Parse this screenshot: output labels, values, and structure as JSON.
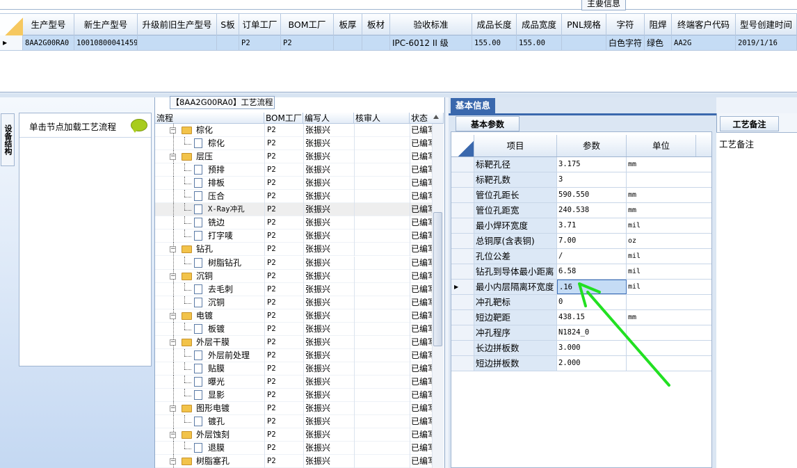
{
  "top_panel": {
    "tab_label": "主要信息",
    "columns": [
      "生产型号",
      "新生产型号",
      "升级前旧生产型号",
      "S板",
      "订单工厂",
      "BOM工厂",
      "板厚",
      "板材",
      "验收标准",
      "成品长度",
      "成品宽度",
      "PNL规格",
      "字符",
      "阻焊",
      "终端客户代码",
      "型号创建时间"
    ],
    "row": [
      "8AA2G00RA0",
      "10010800041459",
      "",
      "",
      "P2",
      "P2",
      "",
      "",
      "IPC-6012 II 级",
      "155.00",
      "155.00",
      "",
      "白色字符",
      "绿色",
      "AA2G",
      "2019/1/16"
    ],
    "row_indicator": "▶"
  },
  "left_panel": {
    "vertical_tab": "设备结构",
    "hint_text": "单击节点加载工艺流程",
    "bubble_icon": "speech-bubble-icon"
  },
  "process_panel": {
    "tab_label": "【8AA2G00RA0】工艺流程",
    "columns": [
      "流程",
      "BOM工厂",
      "编写人",
      "核审人",
      "状态"
    ],
    "rows": [
      {
        "name": "棕化",
        "level": 0,
        "bom": "P2",
        "author": "张振兴",
        "reviewer": "",
        "status": "已编写"
      },
      {
        "name": "棕化",
        "level": 1,
        "bom": "P2",
        "author": "张振兴",
        "reviewer": "",
        "status": "已编写"
      },
      {
        "name": "层压",
        "level": 0,
        "bom": "P2",
        "author": "张振兴",
        "reviewer": "",
        "status": "已编写"
      },
      {
        "name": "预排",
        "level": 1,
        "bom": "P2",
        "author": "张振兴",
        "reviewer": "",
        "status": "已编写"
      },
      {
        "name": "排板",
        "level": 1,
        "bom": "P2",
        "author": "张振兴",
        "reviewer": "",
        "status": "已编写"
      },
      {
        "name": "压合",
        "level": 1,
        "bom": "P2",
        "author": "张振兴",
        "reviewer": "",
        "status": "已编写"
      },
      {
        "name": "X-Ray冲孔",
        "level": 1,
        "bom": "P2",
        "author": "张振兴",
        "reviewer": "",
        "status": "已编写"
      },
      {
        "name": "铣边",
        "level": 1,
        "bom": "P2",
        "author": "张振兴",
        "reviewer": "",
        "status": "已编写"
      },
      {
        "name": "打字唛",
        "level": 1,
        "bom": "P2",
        "author": "张振兴",
        "reviewer": "",
        "status": "已编写"
      },
      {
        "name": "钻孔",
        "level": 0,
        "bom": "P2",
        "author": "张振兴",
        "reviewer": "",
        "status": "已编写"
      },
      {
        "name": "树脂钻孔",
        "level": 1,
        "bom": "P2",
        "author": "张振兴",
        "reviewer": "",
        "status": "已编写"
      },
      {
        "name": "沉铜",
        "level": 0,
        "bom": "P2",
        "author": "张振兴",
        "reviewer": "",
        "status": "已编写"
      },
      {
        "name": "去毛刺",
        "level": 1,
        "bom": "P2",
        "author": "张振兴",
        "reviewer": "",
        "status": "已编写"
      },
      {
        "name": "沉铜",
        "level": 1,
        "bom": "P2",
        "author": "张振兴",
        "reviewer": "",
        "status": "已编写"
      },
      {
        "name": "电镀",
        "level": 0,
        "bom": "P2",
        "author": "张振兴",
        "reviewer": "",
        "status": "已编写"
      },
      {
        "name": "板镀",
        "level": 1,
        "bom": "P2",
        "author": "张振兴",
        "reviewer": "",
        "status": "已编写"
      },
      {
        "name": "外层干膜",
        "level": 0,
        "bom": "P2",
        "author": "张振兴",
        "reviewer": "",
        "status": "已编写"
      },
      {
        "name": "外层前处理",
        "level": 1,
        "bom": "P2",
        "author": "张振兴",
        "reviewer": "",
        "status": "已编写"
      },
      {
        "name": "贴膜",
        "level": 1,
        "bom": "P2",
        "author": "张振兴",
        "reviewer": "",
        "status": "已编写"
      },
      {
        "name": "曝光",
        "level": 1,
        "bom": "P2",
        "author": "张振兴",
        "reviewer": "",
        "status": "已编写"
      },
      {
        "name": "显影",
        "level": 1,
        "bom": "P2",
        "author": "张振兴",
        "reviewer": "",
        "status": "已编写"
      },
      {
        "name": "图形电镀",
        "level": 0,
        "bom": "P2",
        "author": "张振兴",
        "reviewer": "",
        "status": "已编写"
      },
      {
        "name": "镀孔",
        "level": 1,
        "bom": "P2",
        "author": "张振兴",
        "reviewer": "",
        "status": "已编写"
      },
      {
        "name": "外层蚀刻",
        "level": 0,
        "bom": "P2",
        "author": "张振兴",
        "reviewer": "",
        "status": "已编写"
      },
      {
        "name": "退膜",
        "level": 1,
        "bom": "P2",
        "author": "张振兴",
        "reviewer": "",
        "status": "已编写"
      },
      {
        "name": "树脂塞孔",
        "level": 0,
        "bom": "P2",
        "author": "张振兴",
        "reviewer": "",
        "status": "已编写"
      }
    ],
    "selected_index": 6
  },
  "basic_info": {
    "tab_label": "基本信息",
    "sub_tab": "基本参数",
    "columns": [
      "项目",
      "参数",
      "单位"
    ],
    "rows": [
      {
        "item": "标靶孔径",
        "value": "3.175",
        "unit": "mm"
      },
      {
        "item": "标靶孔数",
        "value": "3",
        "unit": ""
      },
      {
        "item": "管位孔距长",
        "value": "590.550",
        "unit": "mm"
      },
      {
        "item": "管位孔距宽",
        "value": "240.538",
        "unit": "mm"
      },
      {
        "item": "最小焊环宽度",
        "value": "3.71",
        "unit": "mil"
      },
      {
        "item": "总铜厚(含表铜)",
        "value": "7.00",
        "unit": "oz"
      },
      {
        "item": "孔位公差",
        "value": "/",
        "unit": "mil"
      },
      {
        "item": "钻孔到导体最小距离",
        "value": "6.58",
        "unit": "mil"
      },
      {
        "item": "最小内层隔离环宽度",
        "value": ".16",
        "unit": "mil"
      },
      {
        "item": "冲孔靶标",
        "value": "0",
        "unit": ""
      },
      {
        "item": "短边靶距",
        "value": "438.15",
        "unit": "mm"
      },
      {
        "item": "冲孔程序",
        "value": "N1824_0",
        "unit": ""
      },
      {
        "item": "长边拼板数",
        "value": "3.000",
        "unit": ""
      },
      {
        "item": "短边拼板数",
        "value": "2.000",
        "unit": ""
      }
    ],
    "active_row": 8,
    "row_indicator": "▶"
  },
  "notes_panel": {
    "tab_label": "工艺备注",
    "content": "工艺备注"
  },
  "colors": {
    "accent": "#3a68ad",
    "selection": "#c5dcf5",
    "annotation_arrow": "#22e022"
  }
}
